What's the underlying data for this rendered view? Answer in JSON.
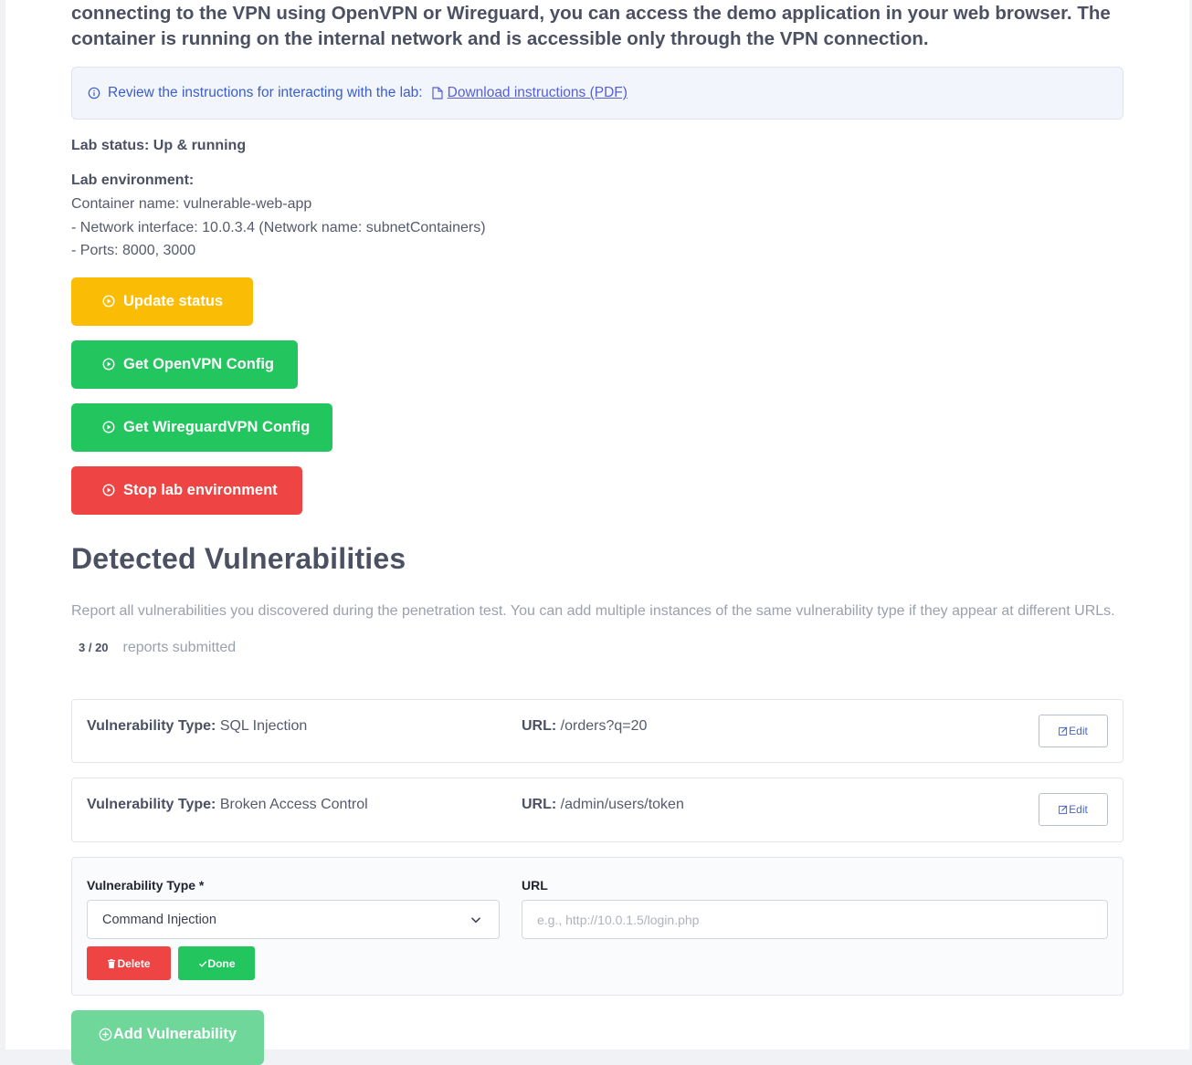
{
  "intro": {
    "text": "connecting to the VPN using OpenVPN or Wireguard, you can access the demo application in your web browser. The container is running on the internal network and is accessible only through the VPN connection."
  },
  "info_box": {
    "text": "Review the instructions for interacting with the lab:",
    "link": "Download instructions (PDF)"
  },
  "lab": {
    "status": "Lab status: Up & running",
    "environment_heading": "Lab environment:",
    "lines": [
      "Container name: vulnerable-web-app",
      "- Network interface: 10.0.3.4 (Network name: subnetContainers)",
      "- Ports: 8000, 3000"
    ]
  },
  "buttons": {
    "update_status": "Update status",
    "openvpn": "Get OpenVPN Config",
    "wireguard": "Get WireguardVPN Config",
    "stop": "Stop lab environment"
  },
  "vulns": {
    "heading": "Detected Vulnerabilities",
    "description": "Report all vulnerabilities you discovered during the penetration test. You can add multiple instances of the same vulnerability type if they appear at different URLs.",
    "count": "3 / 20",
    "count_label": "reports submitted",
    "type_label": "Vulnerability Type:",
    "url_label": "URL:",
    "edit_label": "Edit",
    "items": [
      {
        "type": "SQL Injection",
        "url": "/orders?q=20"
      },
      {
        "type": "Broken Access Control",
        "url": "/admin/users/token"
      }
    ],
    "form": {
      "type_label": "Vulnerability Type *",
      "type_value": "Command Injection",
      "url_label": "URL",
      "url_placeholder": "e.g., http://10.0.1.5/login.php",
      "delete_label": "Delete",
      "done_label": "Done"
    },
    "add_label": "Add Vulnerability"
  },
  "colors": {
    "yellow": "#fbbc05",
    "green": "#22c55e",
    "red": "#ef4444",
    "link": "#5560d4"
  }
}
